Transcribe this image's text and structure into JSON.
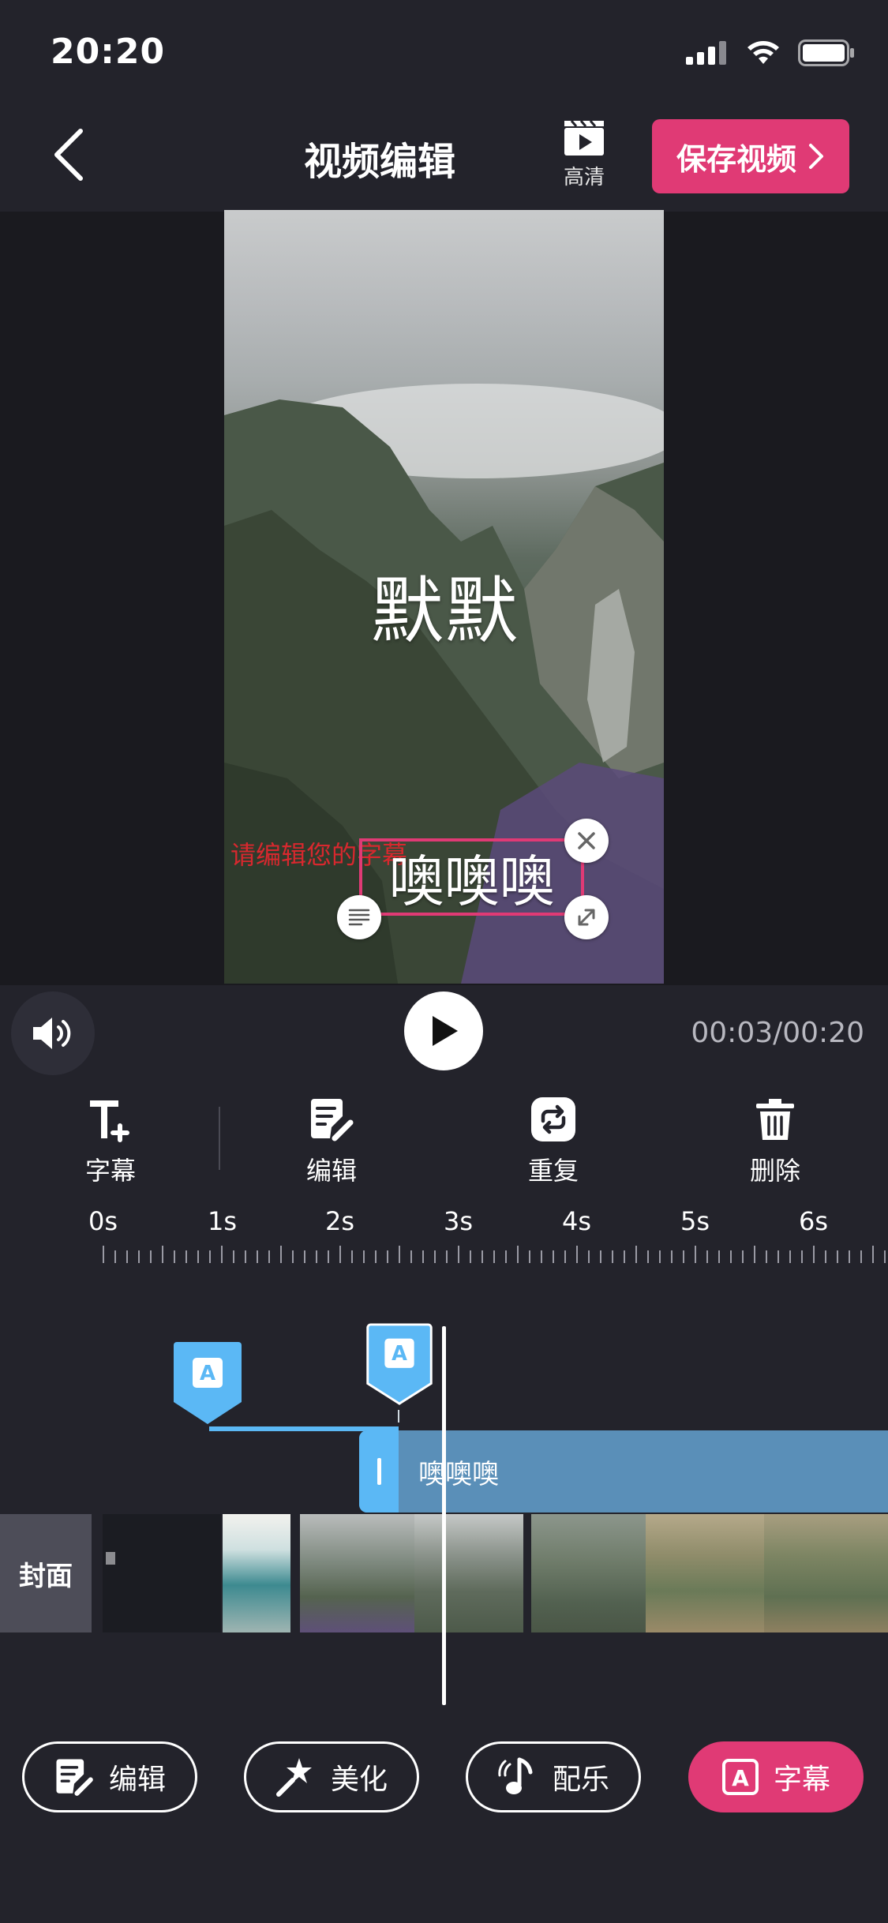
{
  "status": {
    "time": "20:20"
  },
  "header": {
    "title": "视频编辑",
    "hd_label": "高清",
    "save_label": "保存视频"
  },
  "preview": {
    "subtitle_main": "默默",
    "subtitle_placeholder": "请编辑您的字幕",
    "subtitle_selected": "噢噢噢"
  },
  "player": {
    "time": "00:03/00:20"
  },
  "tools": [
    {
      "label": "字幕",
      "icon": "add-text-icon"
    },
    {
      "label": "编辑",
      "icon": "edit-icon"
    },
    {
      "label": "重复",
      "icon": "repeat-icon"
    },
    {
      "label": "删除",
      "icon": "trash-icon"
    }
  ],
  "ruler": {
    "labels": [
      "0s",
      "1s",
      "2s",
      "3s",
      "4s",
      "5s",
      "6s"
    ]
  },
  "timeline": {
    "subtitle_clip_text": "噢噢噢",
    "cover_label": "封面"
  },
  "bottom_nav": [
    {
      "label": "编辑",
      "icon": "edit-icon",
      "active": false
    },
    {
      "label": "美化",
      "icon": "magic-wand-icon",
      "active": false
    },
    {
      "label": "配乐",
      "icon": "music-note-icon",
      "active": false
    },
    {
      "label": "字幕",
      "icon": "subtitle-icon",
      "active": true
    }
  ],
  "colors": {
    "accent": "#e03a75",
    "background": "#23232b",
    "marker_blue": "#5bb8f5",
    "clip_blue": "#5a8fb8"
  }
}
